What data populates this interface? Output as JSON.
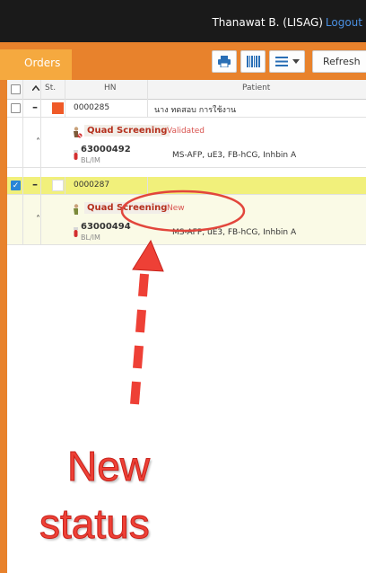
{
  "header": {
    "user_name": "Thanawat B. (LISAG)",
    "logout_label": "Logout"
  },
  "toolbar": {
    "orders_tab": "Orders",
    "refresh_label": "Refresh",
    "icons": [
      "print-icon",
      "barcode-icon",
      "menu-icon"
    ]
  },
  "table": {
    "columns": {
      "status": "St.",
      "hn": "HN",
      "patient": "Patient"
    },
    "orders": [
      {
        "hn": "0000285",
        "patient": "นาง ทดสอบ การใช้งาน",
        "status_color": "#ef5a28",
        "test_name": "Quad Screening",
        "test_status": "Validated",
        "lab_no": "63000492",
        "specimen": "BL/IM",
        "tests": "MS-AFP, uE3, FB-hCG, Inhbin A"
      },
      {
        "hn": "0000287",
        "patient": "",
        "status_color": "#ffffff",
        "test_name": "Quad Screening",
        "test_status": "New",
        "lab_no": "63000494",
        "specimen": "BL/IM",
        "tests": "MS-AFP, uE3, FB-hCG, Inhbin A"
      }
    ]
  },
  "annotation": {
    "label_line1": "New",
    "label_line2": "status",
    "color": "#ee4036"
  }
}
